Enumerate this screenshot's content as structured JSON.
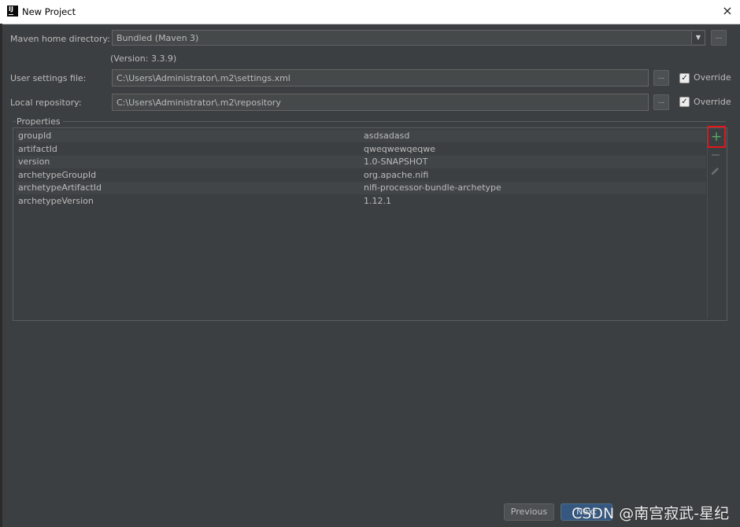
{
  "window": {
    "title": "New Project",
    "close_icon": "×"
  },
  "maven": {
    "home_label": "Maven home directory:",
    "home_value": "Bundled (Maven 3)",
    "version_note": "(Version: 3.3.9)",
    "settings_label": "User settings file:",
    "settings_value": "C:\\Users\\Administrator\\.m2\\settings.xml",
    "repository_label": "Local repository:",
    "repository_value": "C:\\Users\\Administrator\\.m2\\repository",
    "override_label": "Override",
    "ellipsis": "...",
    "dropdown_arrow": "▼",
    "checkmark": "✓"
  },
  "properties": {
    "group_label": "Properties",
    "rows": [
      {
        "key": "groupId",
        "value": "asdsadasd"
      },
      {
        "key": "artifactId",
        "value": "qweqwewqeqwe"
      },
      {
        "key": "version",
        "value": "1.0-SNAPSHOT"
      },
      {
        "key": "archetypeGroupId",
        "value": "org.apache.nifi"
      },
      {
        "key": "archetypeArtifactId",
        "value": "nifi-processor-bundle-archetype"
      },
      {
        "key": "archetypeVersion",
        "value": "1.12.1"
      }
    ],
    "add_symbol": "+"
  },
  "buttons": {
    "previous": "Previous",
    "next": "Next"
  },
  "watermark": "CSDN @南宫寂武-星纪",
  "colors": {
    "background": "#3c3f41",
    "highlight_border": "#e0161b",
    "add_icon": "#59a869",
    "primary_button": "#365880"
  }
}
